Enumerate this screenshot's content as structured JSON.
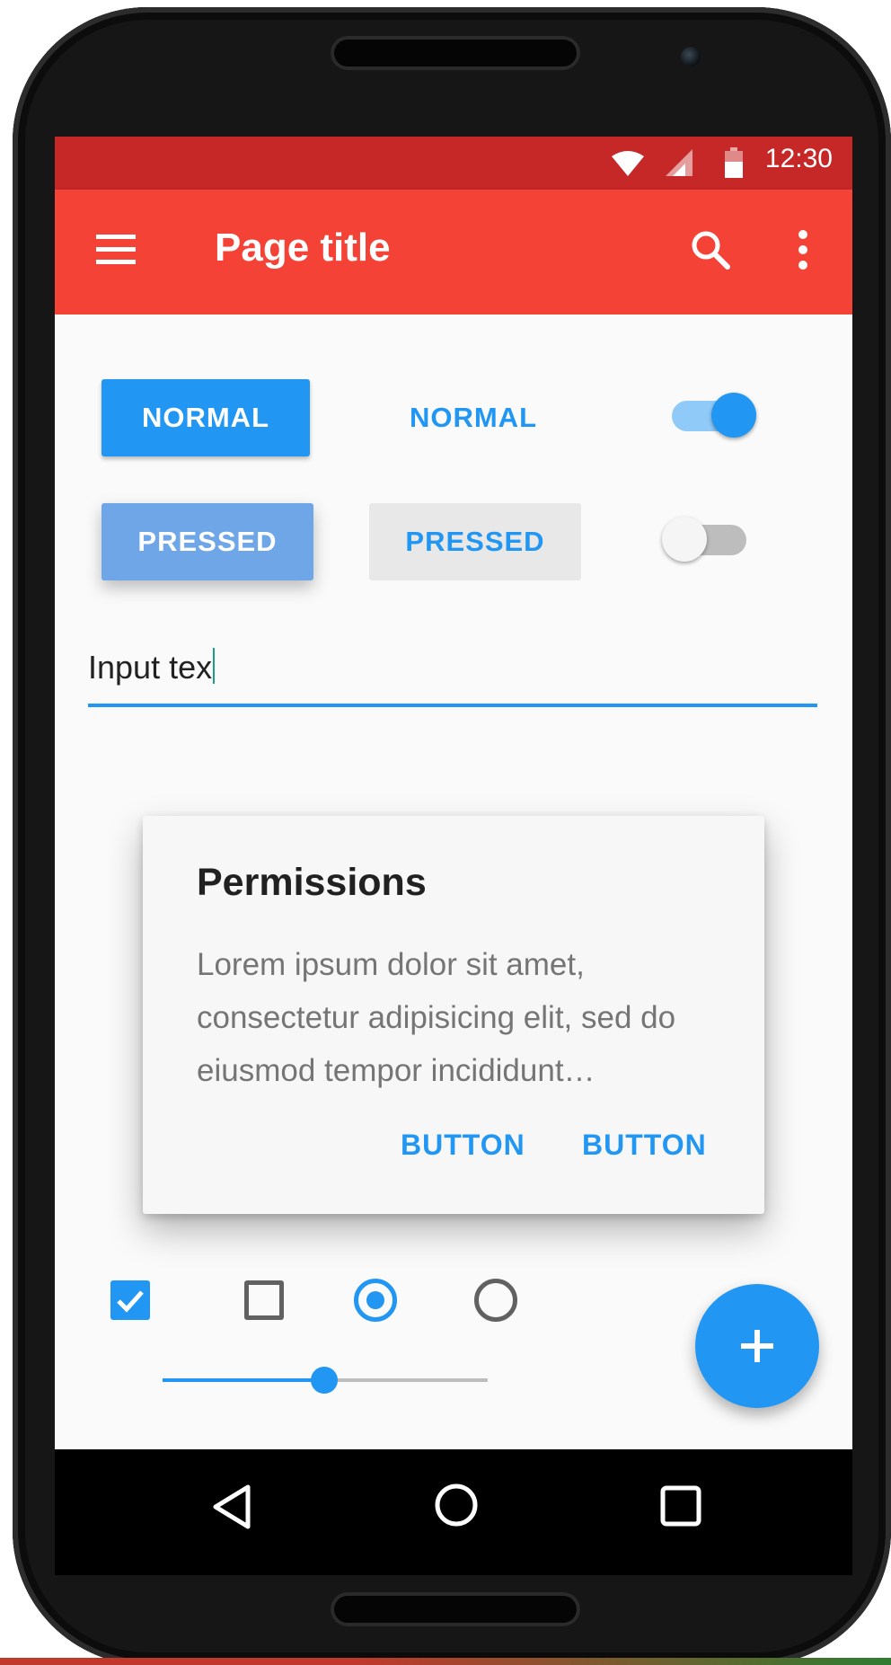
{
  "status_bar": {
    "time": "12:30"
  },
  "app_bar": {
    "title": "Page title"
  },
  "buttons": {
    "raised_normal": "NORMAL",
    "flat_normal": "NORMAL",
    "raised_pressed": "PRESSED",
    "flat_pressed": "PRESSED"
  },
  "switches": {
    "first_on": true,
    "second_on": false
  },
  "text_field": {
    "value": "Input tex"
  },
  "dialog": {
    "title": "Permissions",
    "body": "Lorem ipsum dolor sit amet, consectetur adipisicing elit, sed do eiusmod tempor incididunt…",
    "button_1": "BUTTON",
    "button_2": "BUTTON"
  },
  "selection_controls": {
    "checkbox_1_checked": true,
    "checkbox_2_checked": false,
    "radio_1_selected": true,
    "radio_2_selected": false
  },
  "slider": {
    "value": 0.5
  },
  "colors": {
    "status_bar": "#c62828",
    "app_bar": "#f44336",
    "accent": "#2196f3"
  }
}
